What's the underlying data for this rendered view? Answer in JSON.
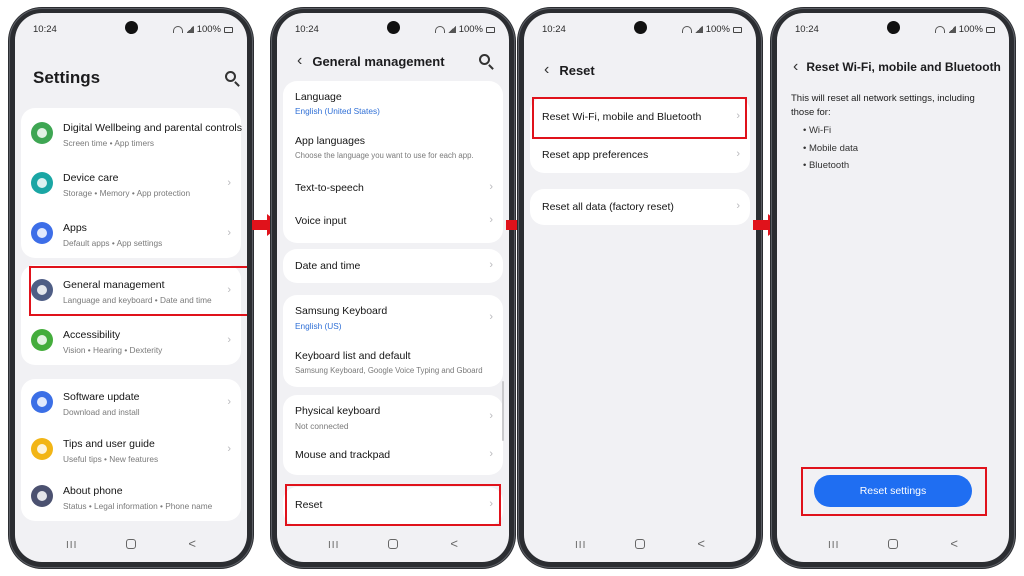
{
  "status": {
    "time": "10:24",
    "battery": "100%"
  },
  "nav": {
    "recent": "III",
    "back": "<"
  },
  "screen1": {
    "title": "Settings",
    "items": [
      {
        "title": "Digital Wellbeing and parental controls",
        "subtitle": "Screen time  •  App timers",
        "icon": "wellbeing-icon",
        "color": "#3ea653"
      },
      {
        "title": "Device care",
        "subtitle": "Storage  •  Memory  •  App protection",
        "icon": "device-care-icon",
        "color": "#1aa6a4"
      },
      {
        "title": "Apps",
        "subtitle": "Default apps  •  App settings",
        "icon": "apps-icon",
        "color": "#3d6ee8"
      },
      {
        "title": "General management",
        "subtitle": "Language and keyboard  •  Date and time",
        "icon": "sliders-icon",
        "color": "#4e5d85"
      },
      {
        "title": "Accessibility",
        "subtitle": "Vision  •  Hearing  •  Dexterity",
        "icon": "accessibility-icon",
        "color": "#44ad3c"
      },
      {
        "title": "Software update",
        "subtitle": "Download and install",
        "icon": "update-icon",
        "color": "#3b6fe6"
      },
      {
        "title": "Tips and user guide",
        "subtitle": "Useful tips  •  New features",
        "icon": "bulb-icon",
        "color": "#f2b516"
      },
      {
        "title": "About phone",
        "subtitle": "Status  •  Legal information  •  Phone name",
        "icon": "info-icon",
        "color": "#4b5170"
      }
    ]
  },
  "screen2": {
    "title": "General management",
    "items": [
      {
        "title": "Language",
        "subtitle": "English (United States)"
      },
      {
        "title": "App languages",
        "subtitle": "Choose the language you want to use for each app."
      },
      {
        "title": "Text-to-speech"
      },
      {
        "title": "Voice input"
      },
      {
        "title": "Date and time"
      },
      {
        "title": "Samsung Keyboard",
        "subtitle": "English (US)"
      },
      {
        "title": "Keyboard list and default",
        "subtitle": "Samsung Keyboard, Google Voice Typing and Gboard"
      },
      {
        "title": "Physical keyboard",
        "subtitle": "Not connected"
      },
      {
        "title": "Mouse and trackpad"
      },
      {
        "title": "Reset"
      }
    ]
  },
  "screen3": {
    "title": "Reset",
    "items": [
      {
        "title": "Reset Wi-Fi, mobile and Bluetooth"
      },
      {
        "title": "Reset app preferences"
      },
      {
        "title": "Reset all data (factory reset)"
      }
    ]
  },
  "screen4": {
    "title": "Reset Wi-Fi, mobile and Bluetooth",
    "description": "This will reset all network settings, including those for:",
    "bullets": [
      "Wi-Fi",
      "Mobile data",
      "Bluetooth"
    ],
    "button": "Reset settings"
  },
  "colors": {
    "highlight": "#e0121b",
    "primary": "#1f6ef2"
  }
}
